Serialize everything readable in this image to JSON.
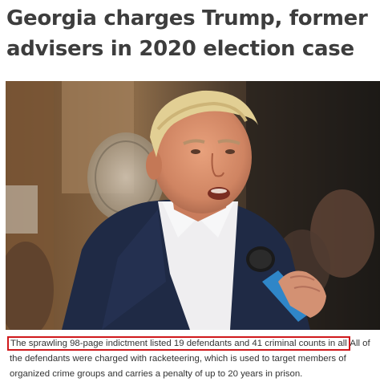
{
  "article": {
    "headline": "Georgia charges Trump, former advisers in 2020 election case",
    "caption_highlight": "The sprawling 98-page indictment listed 19 defendants and 41 criminal counts in all",
    "caption_rest": " All of the defendants were charged with racketeering, which is used to target members of organized crime groups and carries a penalty of up to 20 years in prison."
  },
  "colors": {
    "headline": "#3d3d3d",
    "highlight_border": "#d0191c",
    "caption_text": "#333333"
  }
}
